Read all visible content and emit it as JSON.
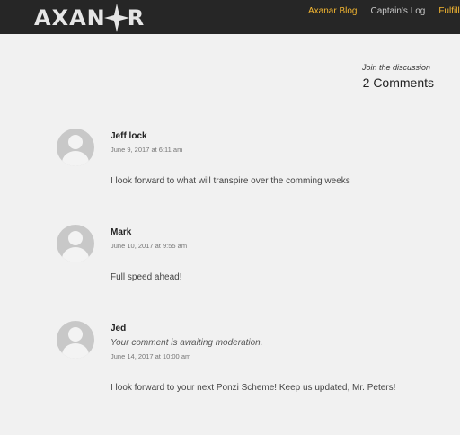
{
  "header": {
    "logo_text_left": "AXAN",
    "logo_text_right": "R",
    "nav": [
      {
        "label": "Axanar Blog"
      },
      {
        "label": "Captain's Log"
      },
      {
        "label": "Fulfillmen"
      }
    ]
  },
  "discussion": {
    "join_label": "Join the discussion",
    "count_label": "2 Comments"
  },
  "comments": [
    {
      "author": "Jeff lock",
      "date": "June 9, 2017 at 6:11 am",
      "text": "I look forward to what will transpire over the comming weeks"
    },
    {
      "author": "Mark",
      "date": "June 10, 2017 at 9:55 am",
      "text": "Full speed ahead!"
    },
    {
      "author": "Jed",
      "moderation": "Your comment is awaiting moderation.",
      "date": "June 14, 2017 at 10:00 am",
      "text": "I look forward to your next Ponzi Scheme! Keep us updated, Mr. Peters!"
    }
  ],
  "colors": {
    "topbar": "#262626",
    "nav_active": "#f5b731",
    "page_bg": "#f1f1f1"
  }
}
